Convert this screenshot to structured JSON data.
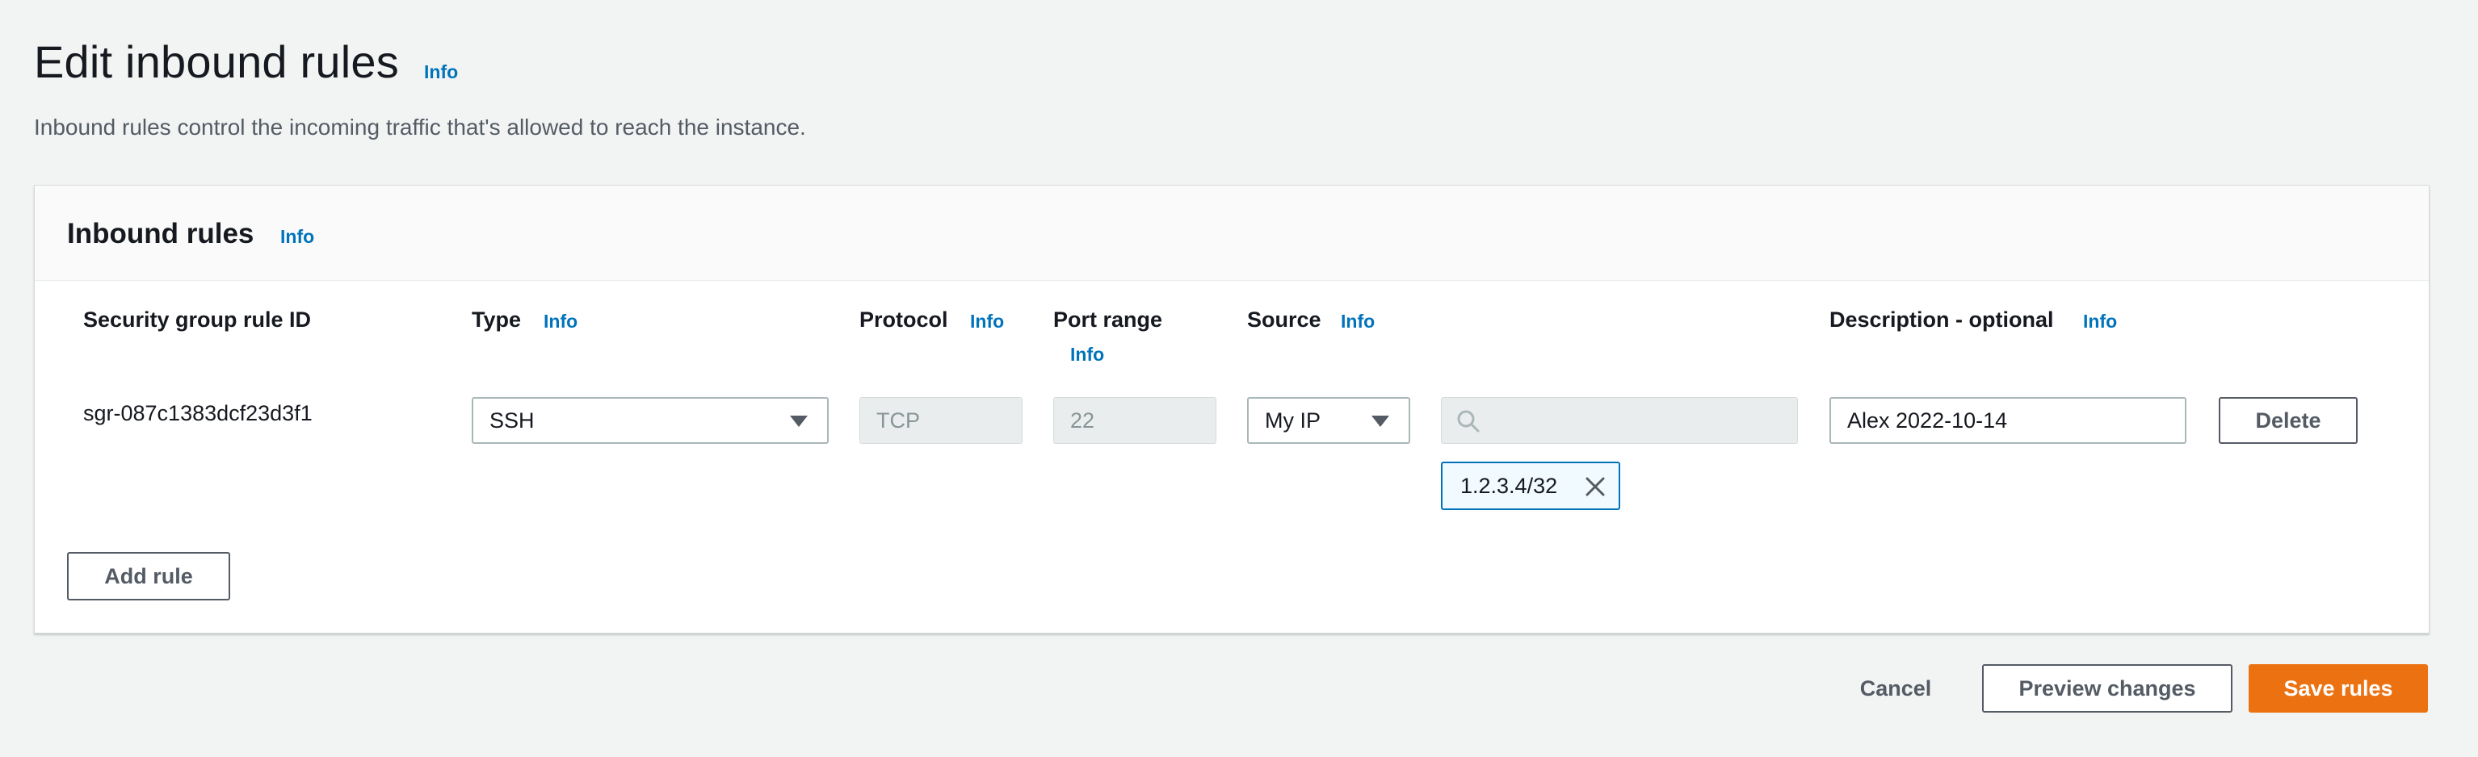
{
  "header": {
    "title": "Edit inbound rules",
    "info": "Info",
    "description": "Inbound rules control the incoming traffic that's allowed to reach the instance."
  },
  "panel": {
    "title": "Inbound rules",
    "info": "Info",
    "columns": {
      "rule_id": "Security group rule ID",
      "type": "Type",
      "type_info": "Info",
      "protocol": "Protocol",
      "protocol_info": "Info",
      "port_range": "Port range",
      "port_range_info": "Info",
      "source": "Source",
      "source_info": "Info",
      "description": "Description - optional",
      "description_info": "Info"
    },
    "rules": [
      {
        "rule_id": "sgr-087c1383dcf23d3f1",
        "type": "SSH",
        "protocol": "TCP",
        "port_range": "22",
        "source": "My IP",
        "source_search_placeholder": "",
        "source_token": "1.2.3.4/32",
        "description": "Alex 2022-10-14",
        "delete_label": "Delete"
      }
    ],
    "add_rule_label": "Add rule"
  },
  "footer": {
    "cancel_label": "Cancel",
    "preview_label": "Preview changes",
    "save_label": "Save rules"
  },
  "colors": {
    "accent": "#0073bb",
    "primary_button": "#ec7211",
    "background": "#f2f3f3"
  },
  "icons": {
    "search": "search-icon",
    "dropdown": "caret-down-icon",
    "remove": "close-icon"
  }
}
